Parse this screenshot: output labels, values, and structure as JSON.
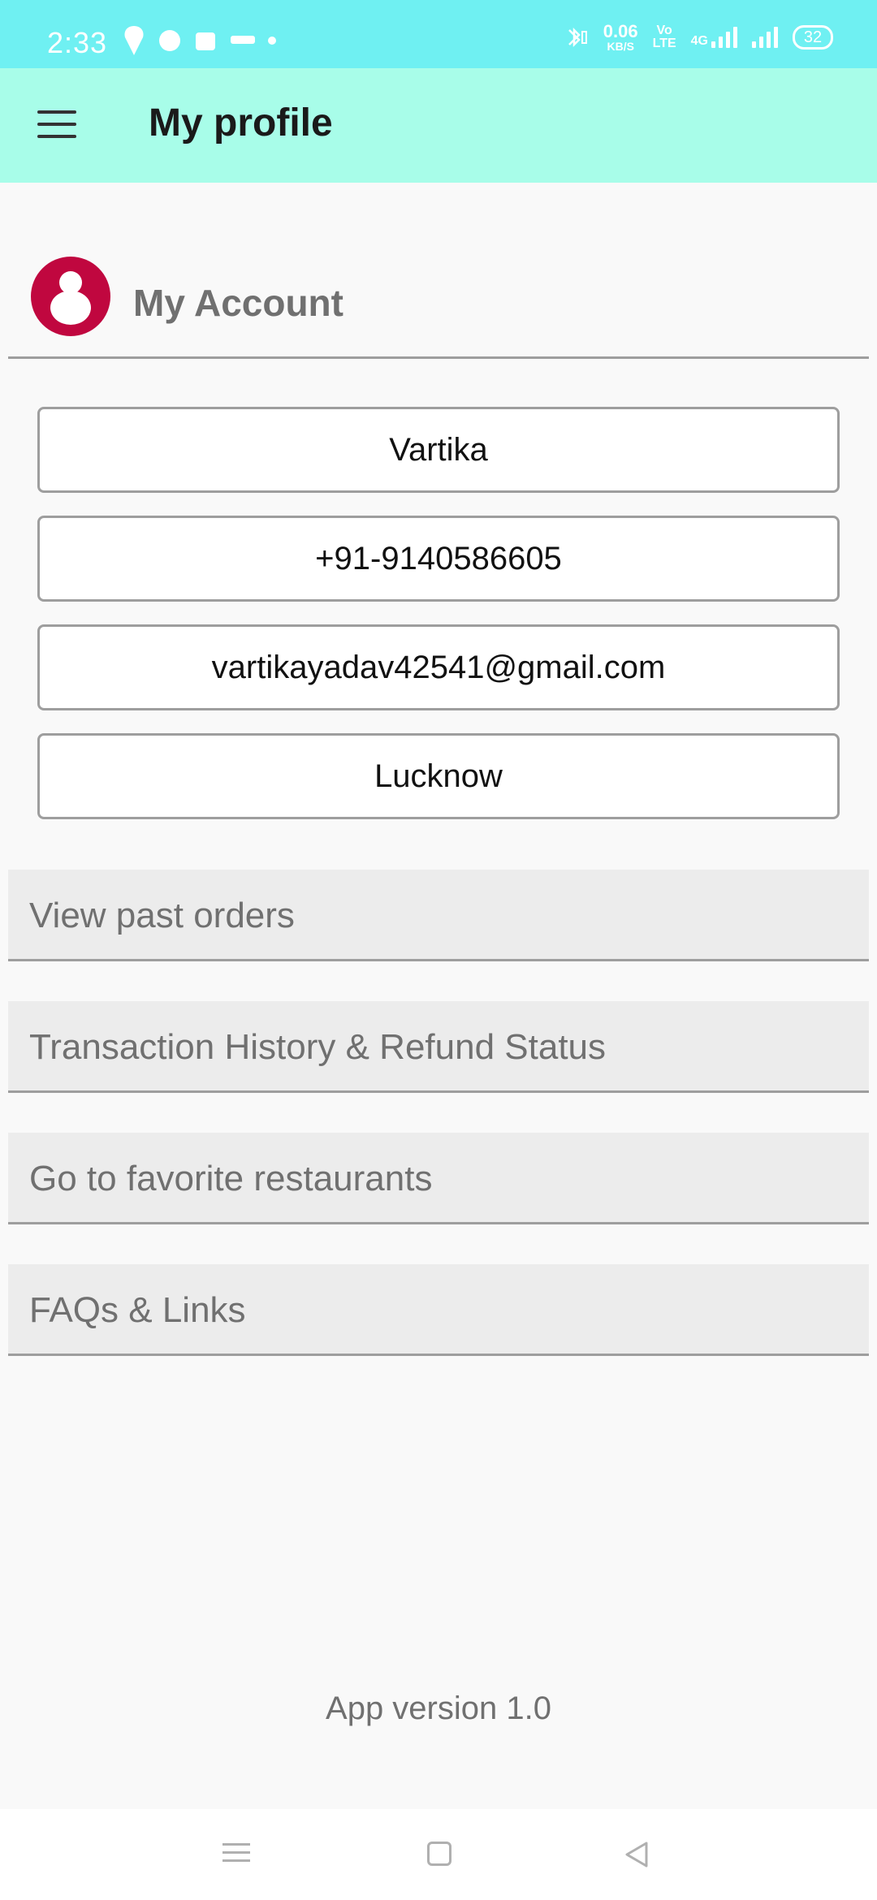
{
  "status_bar": {
    "time": "2:33",
    "left_icons": [
      "swiggy-icon",
      "jio-icon",
      "myntra-icon",
      "voot-icon",
      "dot-icon"
    ],
    "network_speed_value": "0.06",
    "network_speed_unit": "KB/S",
    "volte_label_top": "Vo",
    "volte_label_bottom": "LTE",
    "network_type": "4G",
    "battery": "32"
  },
  "app_bar": {
    "title": "My profile"
  },
  "account": {
    "title": "My Account",
    "fields": {
      "name": "Vartika",
      "phone": "+91-9140586605",
      "email": "vartikayadav42541@gmail.com",
      "city": "Lucknow"
    }
  },
  "menu": {
    "past_orders": "View past orders",
    "transactions": "Transaction History & Refund Status",
    "favorites": "Go to favorite restaurants",
    "faqs": "FAQs & Links"
  },
  "footer": {
    "version": "App version 1.0"
  },
  "colors": {
    "status_bar": "#6ff0f2",
    "app_bar": "#a8fde9",
    "avatar": "#c0073f"
  }
}
